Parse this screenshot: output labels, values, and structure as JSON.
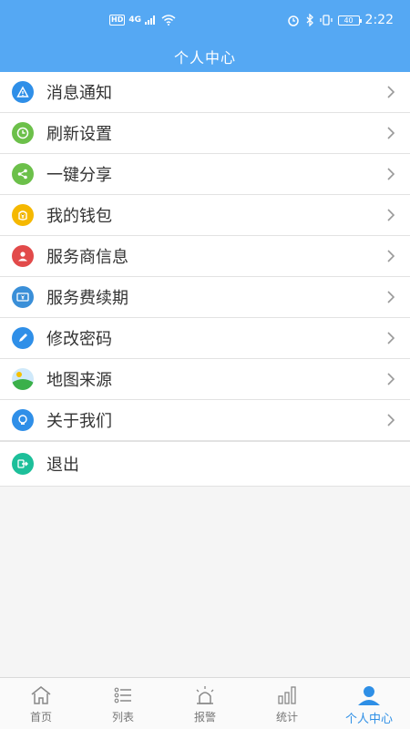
{
  "status_bar": {
    "hd": "HD",
    "network": "4G",
    "battery": "40",
    "time": "2:22"
  },
  "header": {
    "title": "个人中心"
  },
  "menu": [
    {
      "label": "消息通知",
      "icon": "warning-icon",
      "color": "#2f8fe8"
    },
    {
      "label": "刷新设置",
      "icon": "clock-icon",
      "color": "#6cc04a"
    },
    {
      "label": "一键分享",
      "icon": "share-icon",
      "color": "#6cc04a"
    },
    {
      "label": "我的钱包",
      "icon": "wallet-icon",
      "color": "#f5b800"
    },
    {
      "label": "服务商信息",
      "icon": "provider-icon",
      "color": "#e24a4a"
    },
    {
      "label": "服务费续期",
      "icon": "ticket-icon",
      "color": "#3a8fd8"
    },
    {
      "label": "修改密码",
      "icon": "pencil-icon",
      "color": "#2f8fe8"
    },
    {
      "label": "地图来源",
      "icon": "map-icon",
      "color": "#4caf50"
    },
    {
      "label": "关于我们",
      "icon": "about-icon",
      "color": "#2f8fe8"
    },
    {
      "label": "退出",
      "icon": "logout-icon",
      "color": "#1dbf9a"
    }
  ],
  "bottom_nav": [
    {
      "label": "首页",
      "icon": "home-icon"
    },
    {
      "label": "列表",
      "icon": "list-icon"
    },
    {
      "label": "报警",
      "icon": "alarm-icon"
    },
    {
      "label": "统计",
      "icon": "stats-icon"
    },
    {
      "label": "个人中心",
      "icon": "person-icon",
      "active": true
    }
  ],
  "colors": {
    "header": "#55a8f3",
    "active_tab": "#2e8fe6"
  }
}
